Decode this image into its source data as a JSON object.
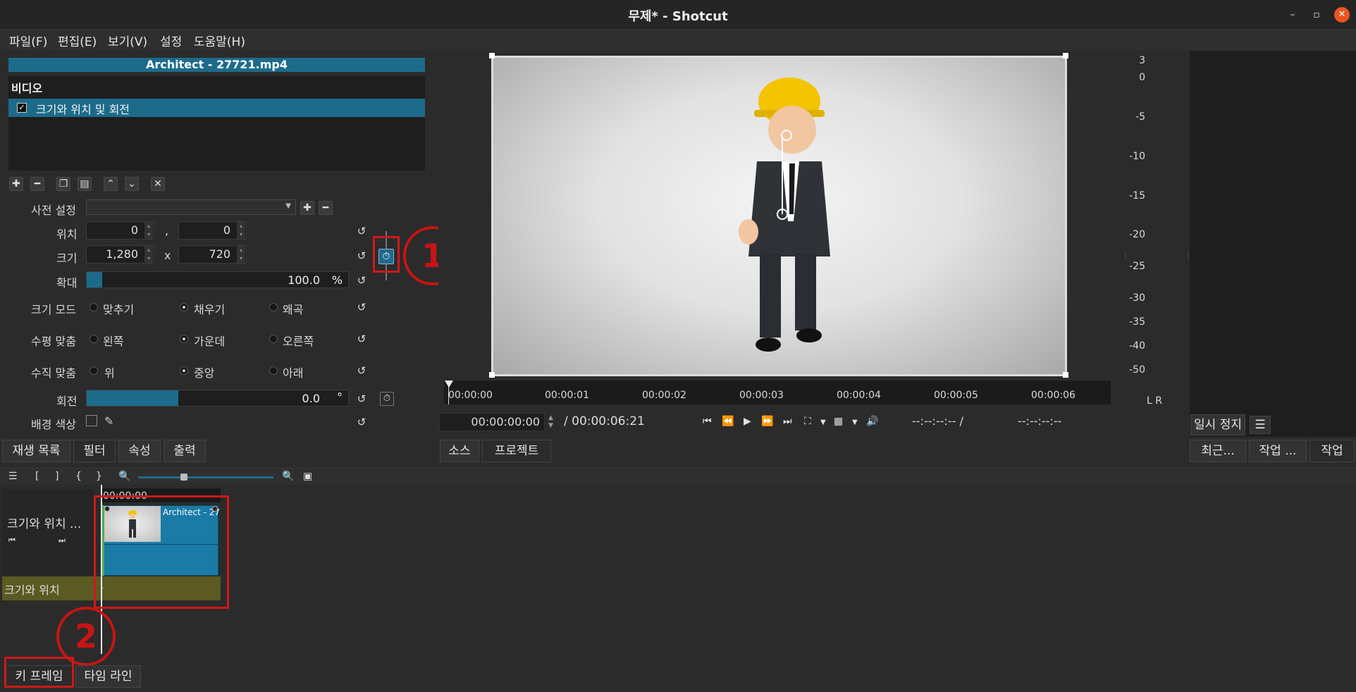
{
  "window": {
    "title": "무제* - Shotcut",
    "controls": {
      "minimize": "–",
      "maximize": "▫",
      "close": "✕"
    }
  },
  "menu": [
    "파일(F)",
    "편집(E)",
    "보기(V)",
    "설정",
    "도움말(H)"
  ],
  "filters": {
    "clip_title": "Architect - 27721.mp4",
    "category": "비디오",
    "items": [
      {
        "label": "크기와 위치 및 회전",
        "checked": true
      }
    ],
    "toolbar_icons": [
      "add-icon",
      "remove-icon",
      "copy-icon",
      "paste-icon",
      "move-up-icon",
      "move-down-icon",
      "close-icon"
    ]
  },
  "properties": {
    "preset_label": "사전 설정",
    "position": {
      "label": "위치",
      "x": "0",
      "sep": ",",
      "y": "0"
    },
    "size": {
      "label": "크기",
      "w": "1,280",
      "sep": "x",
      "h": "720"
    },
    "zoom": {
      "label": "확대",
      "value": "100.0",
      "unit": "%",
      "fill": 0.06
    },
    "size_mode": {
      "label": "크기 모드",
      "options": [
        "맞추기",
        "채우기",
        "왜곡"
      ],
      "selected": 1
    },
    "h_align": {
      "label": "수평 맞춤",
      "options": [
        "왼쪽",
        "가운데",
        "오른쪽"
      ],
      "selected": 1
    },
    "v_align": {
      "label": "수직 맞춤",
      "options": [
        "위",
        "중앙",
        "아래"
      ],
      "selected": 1
    },
    "rotation": {
      "label": "회전",
      "value": "0.0",
      "unit": "°",
      "fill": 0.35
    },
    "bg_color": {
      "label": "배경 색상"
    }
  },
  "annotations": {
    "one": "1",
    "two": "2"
  },
  "player": {
    "ruler_ticks": [
      "00:00:00",
      "00:00:01",
      "00:00:02",
      "00:00:03",
      "00:00:04",
      "00:00:05",
      "00:00:06"
    ],
    "position": "00:00:00:00",
    "duration": "/ 00:00:06:21",
    "in_point": "--:--:--:-- /",
    "out_point": "--:--:--:--"
  },
  "meter": {
    "scale": [
      "3",
      "0",
      "-5",
      "-10",
      "-15",
      "-20",
      "-25",
      "-30",
      "-35",
      "-40",
      "-50"
    ],
    "channels": "L R"
  },
  "left_tabs": [
    "재생 목록",
    "필터",
    "속성",
    "출력"
  ],
  "player_tabs": [
    "소스",
    "프로젝트"
  ],
  "right_tabs": [
    "최근...",
    "작업 ...",
    "작업"
  ],
  "right_buttons": {
    "pause": "일시 정지",
    "menu": "☰"
  },
  "keyframes": {
    "toolbar": [
      "☰",
      "[",
      "]",
      "{",
      "}"
    ],
    "ruler_time": "00:00:00",
    "track_name": "크기와 위치 ...",
    "clip_name": "Architect - 27",
    "filter_track": "크기와 위치"
  },
  "bottom_tabs": [
    "키 프레임",
    "타임 라인"
  ]
}
